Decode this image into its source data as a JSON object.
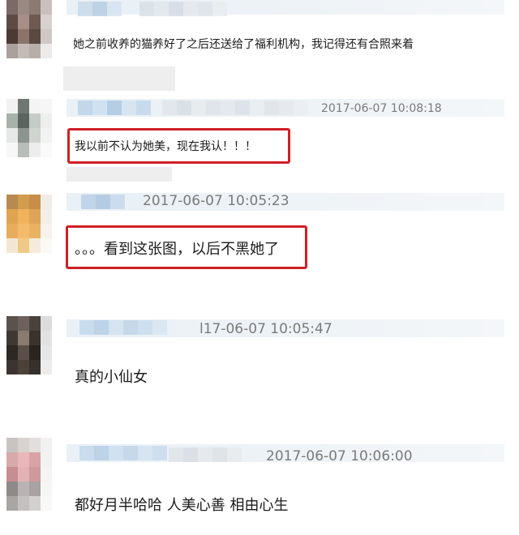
{
  "comments": [
    {
      "text": "她之前收养的猫养好了之后还送给了福利机构，我记得还有合照来着",
      "timestamp": "",
      "highlighted": false
    },
    {
      "text": "我以前不认为她美，现在我认！！！",
      "timestamp": "2017-06-07 10:08:18",
      "highlighted": true
    },
    {
      "text": "。。。看到这张图，以后不黑她了",
      "timestamp": "2017-06-07 10:05:23",
      "highlighted": true
    },
    {
      "text": "真的小仙女",
      "timestamp": "l17-06-07 10:05:47",
      "highlighted": false
    },
    {
      "text": "都好月半哈哈 人美心善 相由心生",
      "timestamp": "2017-06-07 10:06:00",
      "highlighted": false
    }
  ],
  "colors": {
    "highlight_border": "#d01f26",
    "timestamp": "#7a7a7a",
    "header_band": "#e9f0f6"
  }
}
